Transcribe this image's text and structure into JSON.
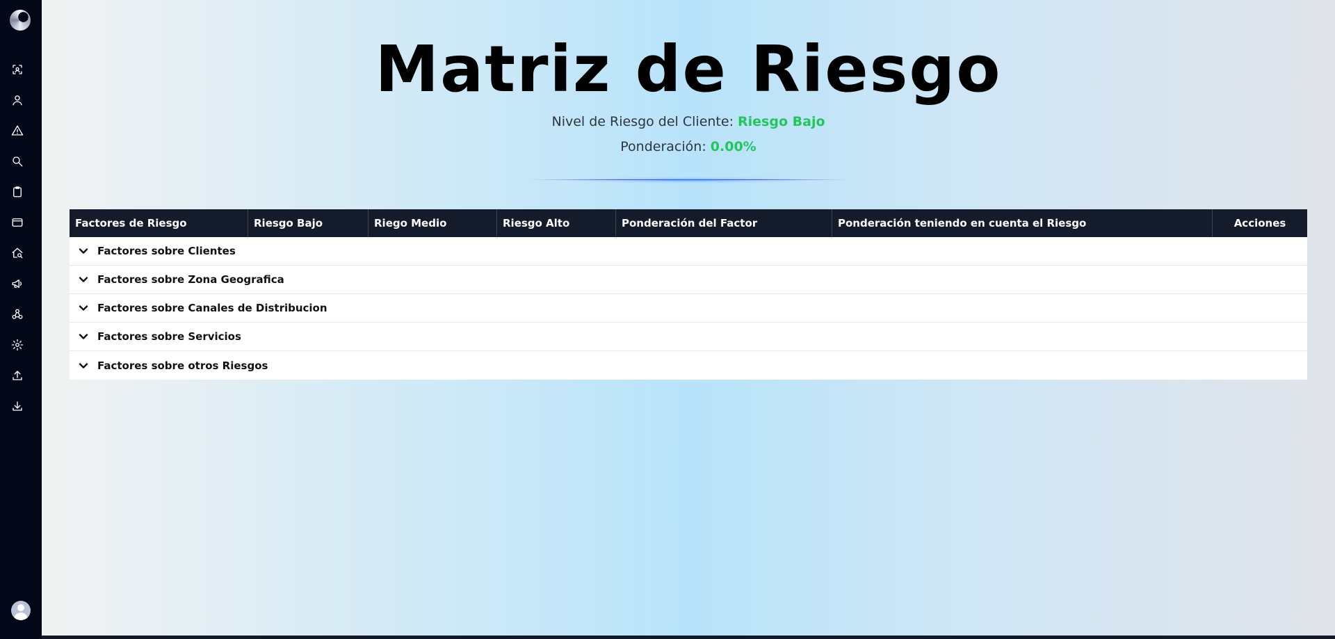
{
  "sidebar": {
    "icons": [
      "face-scan-icon",
      "user-icon",
      "warning-icon",
      "search-icon",
      "clipboard-icon",
      "card-icon",
      "home-search-icon",
      "megaphone-icon",
      "network-icon",
      "gear-icon",
      "upload-icon",
      "download-icon"
    ]
  },
  "header": {
    "title": "Matriz de Riesgo",
    "risk_level_label": "Nivel de Riesgo del Cliente:",
    "risk_level_value": "Riesgo Bajo",
    "weighting_label": "Ponderación:",
    "weighting_value": "0.00%",
    "accent_color": "#22c55e"
  },
  "table": {
    "columns": [
      "Factores de Riesgo",
      "Riesgo Bajo",
      "Riego Medio",
      "Riesgo Alto",
      "Ponderación del Factor",
      "Ponderación teniendo en cuenta el Riesgo",
      "Acciones"
    ],
    "groups": [
      "Factores sobre Clientes",
      "Factores sobre Zona Geografica",
      "Factores sobre Canales de Distribucion",
      "Factores sobre Servicios",
      "Factores sobre otros Riesgos"
    ]
  }
}
